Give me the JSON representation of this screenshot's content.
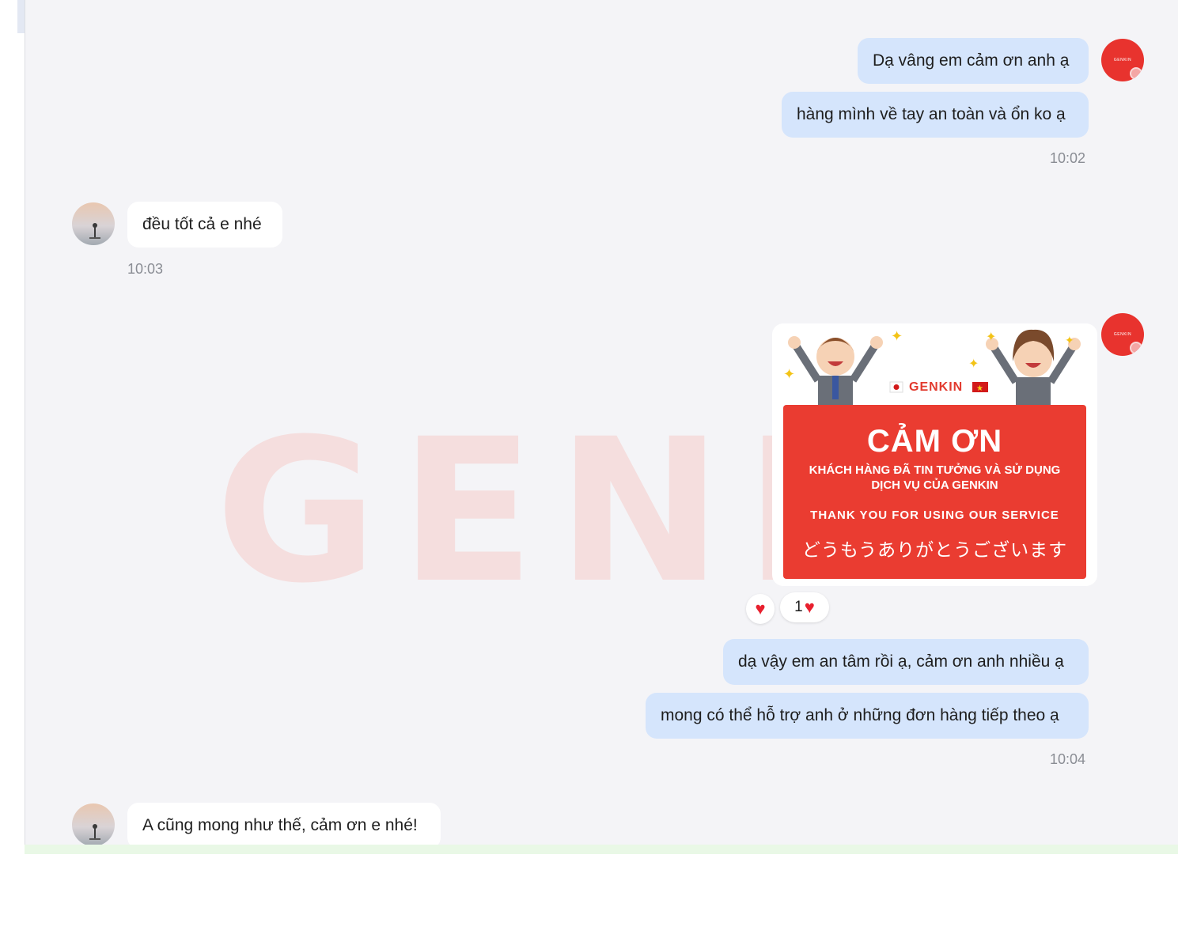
{
  "watermark": "GENKI",
  "messages": {
    "m1": "Dạ vâng em cảm ơn anh ạ",
    "m2": "hàng mình về tay an toàn và ổn ko ạ",
    "t1": "10:02",
    "m3": "đều tốt cả e nhé",
    "t2": "10:03",
    "m4": "dạ vậy em an tâm rồi ạ, cảm ơn anh nhiều ạ",
    "m5": "mong có thể hỗ trợ anh ở những đơn hàng tiếp theo ạ",
    "t3": "10:04",
    "m6": "A cũng mong như thế, cảm ơn e nhé!"
  },
  "sticker": {
    "brand": "GENKIN",
    "title": "CẢM ƠN",
    "line1": "KHÁCH HÀNG ĐÃ TIN TƯỞNG VÀ SỬ DỤNG",
    "line2": "DỊCH VỤ CỦA GENKIN",
    "english": "THANK YOU FOR USING OUR SERVICE",
    "japanese": "どうもうありがとうございます"
  },
  "reactions": {
    "count": "1",
    "icon": "heart-icon"
  },
  "avatar_label": "GENKIN",
  "colors": {
    "my_bubble": "#d5e5fc",
    "their_bubble": "#ffffff",
    "brand_red": "#e8332e"
  }
}
